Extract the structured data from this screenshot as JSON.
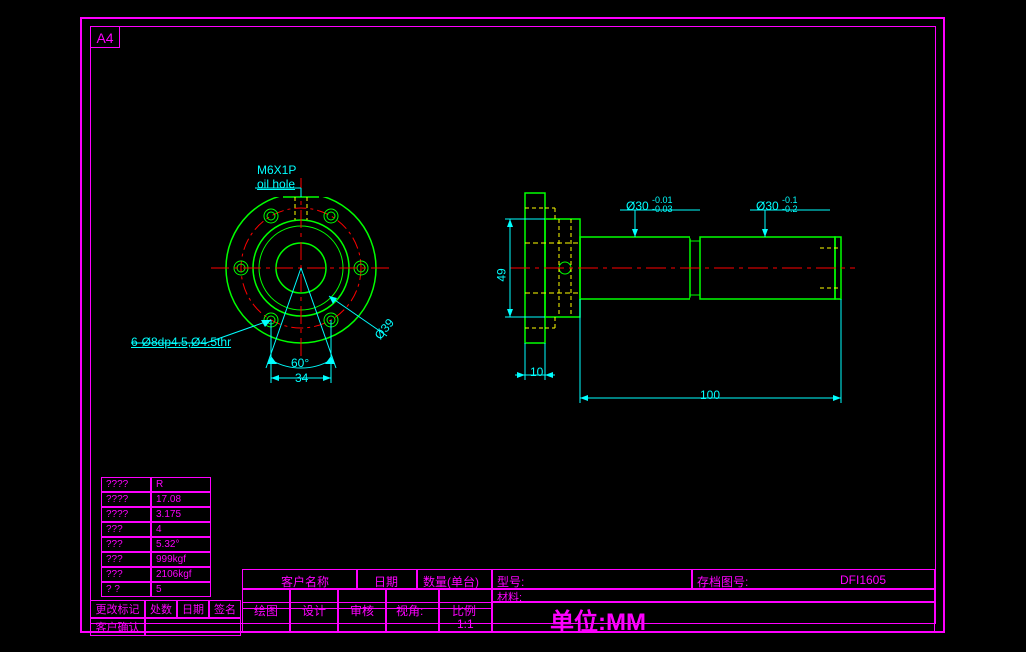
{
  "sheet": "A4",
  "annotations": {
    "thread": "M6X1P",
    "oil_hole": "oil hole",
    "holes": "6-Ø8dp4.5,Ø4.5thr",
    "diam39": "Ø39",
    "angle60": "60°",
    "dim34": "34",
    "dim49": "49",
    "dim10": "10",
    "dim100": "100",
    "tol1": "Ø30",
    "tol1_upper": "-0.01",
    "tol1_lower": "-0.03",
    "tol2": "Ø30",
    "tol2_upper": "-0.1",
    "tol2_lower": "-0.2"
  },
  "specs": {
    "r1c1": "????",
    "r1c2": "R",
    "r2c1": "????",
    "r2c2": "17.08",
    "r3c1": "????",
    "r3c2": "3.175",
    "r4c1": "???",
    "r4c2": "4",
    "r5c1": "???",
    "r5c2": "5.32°",
    "r6c1": "???",
    "r6c2": "999kgf",
    "r7c1": "???",
    "r7c2": "2106kgf",
    "r8c1": "?   ?",
    "r8c2": "5"
  },
  "bottom_left": {
    "change_mark": "更改标记",
    "qty": "处数",
    "date": "日期",
    "sign": "签名",
    "cust_confirm": "客户确认"
  },
  "titleblock": {
    "customer": "客户名称",
    "date": "日期",
    "qty_unit": "数量(单台)",
    "model": "型号:",
    "archive": "存档图号:",
    "archive_no": "DFI1605",
    "material": "材料:",
    "draw": "绘图",
    "design": "设计",
    "check": "审核",
    "view": "视角:",
    "scale": "比例",
    "scale_val": "1:1",
    "unit": "单位:MM"
  }
}
